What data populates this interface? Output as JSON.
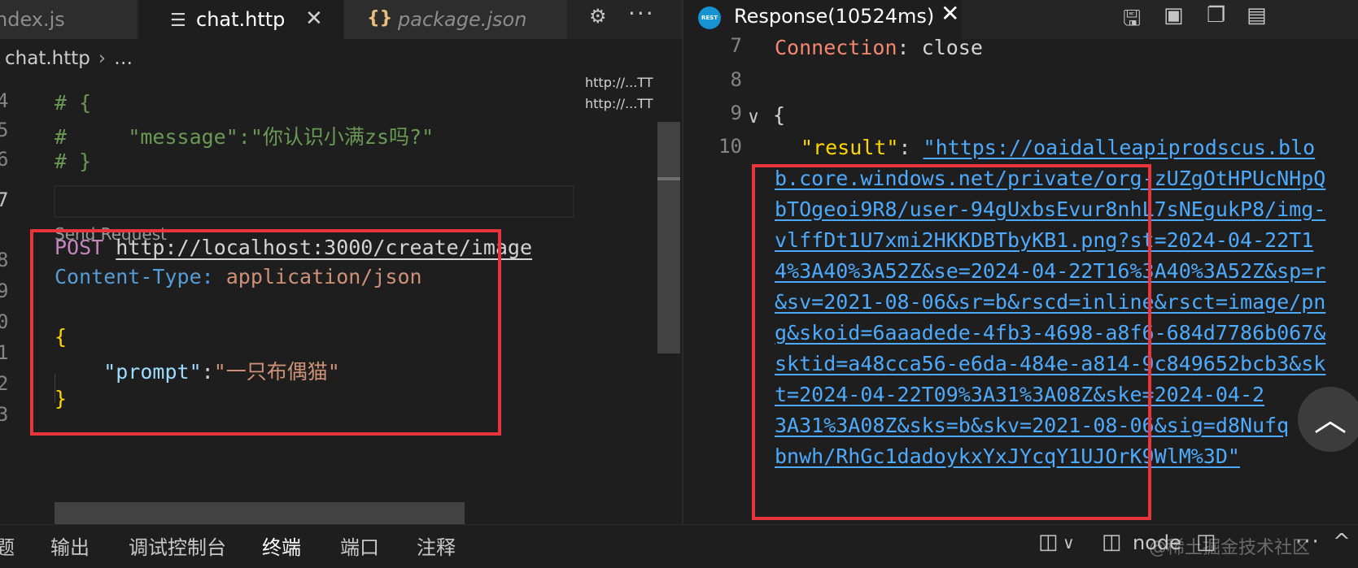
{
  "left_editor": {
    "tabs": [
      {
        "label": "index.js",
        "visible_label": "ndex.js"
      },
      {
        "label": "chat.http",
        "close": "✕"
      },
      {
        "label": "package.json",
        "icon": "{}"
      }
    ],
    "breadcrumb": {
      "file": "chat.http",
      "rest": "…"
    },
    "line_numbers": [
      "4",
      "5",
      "6",
      "7",
      "8",
      "9",
      "0",
      "1",
      "2",
      "3"
    ],
    "code": {
      "c1": "# {",
      "c2_hash": "#",
      "c2_key": "\"message\"",
      "c2_colon": ":",
      "c2_val": "\"你认识小满zs吗?\"",
      "c3": "# }",
      "codelens": "Send Request",
      "method": "POST",
      "url": "http://localhost:3000/create/image",
      "header_key": "Content-Type:",
      "header_val": "application/json",
      "open_brace": "{",
      "body_key": "\"prompt\"",
      "body_colon": ":",
      "body_val": "\"一只布偶猫\"",
      "close_brace": "}"
    },
    "minimap": [
      "http://...TTI",
      "http://...TTI"
    ]
  },
  "response_pane": {
    "tab_label": "Response(10524ms)",
    "rest_icon_text": "REST",
    "line_numbers": [
      "7",
      "8",
      "9",
      "10"
    ],
    "header_key": "Connection",
    "header_sep": ":",
    "header_val": "close",
    "open_brace": "{",
    "result_key": "\"result\"",
    "result_colon": ":",
    "result_lines": [
      "\"https://oaidalleapiprodscus.blo",
      "b.core.windows.net/private/org-zUZgOtHPUcNHpQ",
      "bTOgeoi9R8/user-94gUxbsEvur8nhL7sNEgukP8/img-",
      "vlffDt1U7xmi2HKKDBTbyKB1.png?st=2024-04-22T1",
      "4%3A40%3A52Z&se=2024-04-22T16%3A40%3A52Z&sp=r",
      "&sv=2021-08-06&sr=b&rscd=inline&rsct=image/pn",
      "g&skoid=6aaadede-4fb3-4698-a8f6-684d7786b067&",
      "sktid=a48cca56-e6da-484e-a814-9c849652bcb3&sk",
      "t=2024-04-22T09%3A31%3A08Z&ske=2024-04-2",
      "3A31%3A08Z&sks=b&skv=2021-08-06&sig=d8Nufq",
      "bnwh/RhGc1dadoykxYxJYcqY1UJOrK9WlM%3D\""
    ]
  },
  "panel": {
    "tabs": [
      "题",
      "输出",
      "调试控制台",
      "终端",
      "端口",
      "注释"
    ],
    "active_tab": "终端",
    "terminal_label": "node",
    "watermark": "@稀土掘金技术社区"
  },
  "colors": {
    "highlight": "#e8343a",
    "link": "#4daafc",
    "comment": "#6a9955",
    "string": "#ce9178"
  }
}
